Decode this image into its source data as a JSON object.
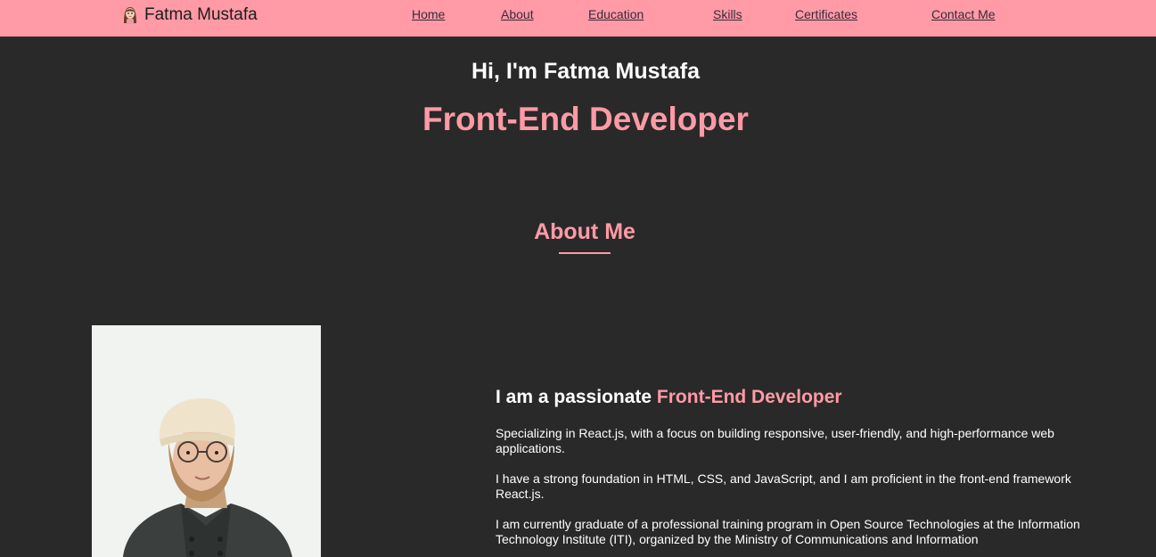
{
  "nav": {
    "brand_name": "Fatma Mustafa",
    "links": {
      "home": "Home",
      "about": "About",
      "education": "Education",
      "skills": "Skills",
      "certificates": "Certificates",
      "contact": "Contact Me"
    }
  },
  "hero": {
    "greeting": "Hi, I'm Fatma Mustafa",
    "role": "Front-End Developer"
  },
  "about": {
    "section_title": "About Me",
    "heading_prefix": "I am a passionate ",
    "heading_accent": "Front-End Developer",
    "paragraphs": [
      "Specializing in React.js, with a focus on building responsive, user-friendly, and high-performance web applications.",
      "I have a strong foundation in HTML, CSS, and JavaScript, and I am proficient in the front-end framework React.js.",
      "I am currently graduate of a professional training program in Open Source Technologies at the Information Technology Institute (ITI), organized by the Ministry of Communications and Information"
    ]
  },
  "colors": {
    "accent": "#ff9aa6",
    "background": "#292929",
    "nav_text": "#3a2a3a"
  },
  "icons": {
    "brand": "girl-avatar-icon"
  }
}
